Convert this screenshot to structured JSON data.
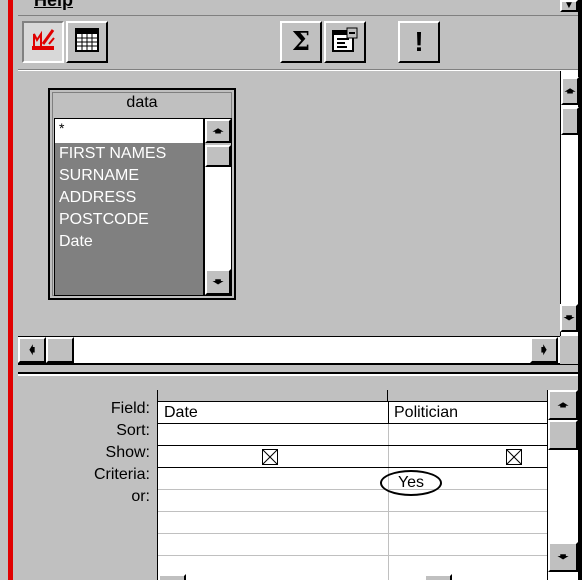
{
  "menu": {
    "partial_label": "Help"
  },
  "toolbar": {
    "design_view_icon": "design-view-icon",
    "datasheet_view_icon": "datasheet-view-icon",
    "totals_symbol": "Σ",
    "properties_icon": "properties-icon",
    "run_symbol": "!"
  },
  "field_list": {
    "title": "data",
    "star": "*",
    "fields": [
      "FIRST NAMES",
      "SURNAME",
      "ADDRESS",
      "POSTCODE",
      "Date"
    ]
  },
  "grid": {
    "row_labels": [
      "Field:",
      "Sort:",
      "Show:",
      "Criteria:",
      "or:"
    ],
    "columns": [
      {
        "field": "Date",
        "sort": "",
        "show": true,
        "criteria": ""
      },
      {
        "field": "Politician",
        "sort": "",
        "show": true,
        "criteria": "Yes"
      }
    ]
  },
  "colors": {
    "accent_red": "#e00000",
    "panel_gray": "#c0c0c0",
    "selected_gray": "#808080"
  }
}
